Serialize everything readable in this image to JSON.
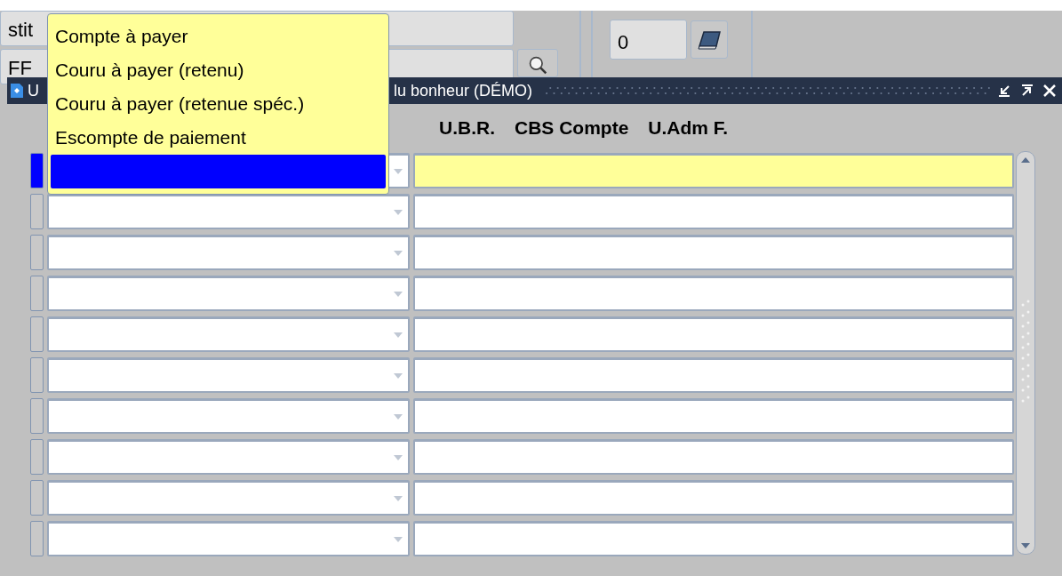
{
  "background_form": {
    "field_1": "stit",
    "field_2": "FF",
    "counter": "0"
  },
  "window": {
    "title_start": "U",
    "title_end": "lu bonheur (DÉMO)"
  },
  "columns": [
    {
      "label": "U.B.R."
    },
    {
      "label": "CBS Compte"
    },
    {
      "label": "U.Adm F."
    }
  ],
  "rows": [
    {
      "selected": true
    },
    {
      "selected": false
    },
    {
      "selected": false
    },
    {
      "selected": false
    },
    {
      "selected": false
    },
    {
      "selected": false
    },
    {
      "selected": false
    },
    {
      "selected": false
    },
    {
      "selected": false
    },
    {
      "selected": false
    }
  ],
  "dropdown": {
    "items": [
      {
        "label": "Compte à payer",
        "selected": false
      },
      {
        "label": "Couru à payer (retenu)",
        "selected": false
      },
      {
        "label": "Couru à payer (retenue spéc.)",
        "selected": false
      },
      {
        "label": "Escompte de paiement",
        "selected": false
      },
      {
        "selected": true
      }
    ]
  }
}
